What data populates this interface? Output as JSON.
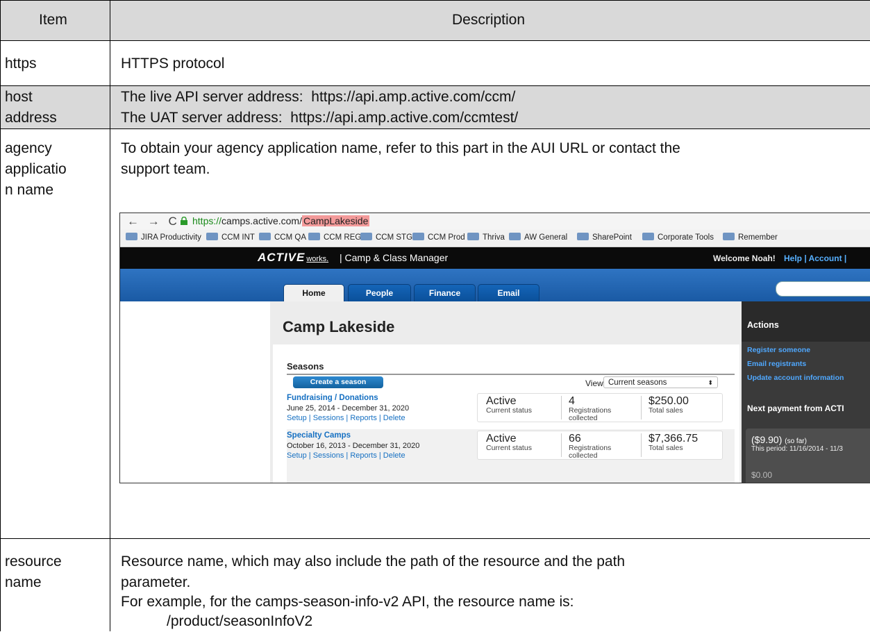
{
  "table": {
    "headers": {
      "item": "Item",
      "description": "Description"
    },
    "rows": [
      {
        "item": "https",
        "lines": [
          "HTTPS protocol"
        ]
      },
      {
        "item_lines": [
          "host",
          "address"
        ],
        "lines": [
          "The live API server address:  https://api.amp.active.com/ccm/",
          "The UAT server address:  https://api.amp.active.com/ccmtest/"
        ]
      },
      {
        "item_lines": [
          "agency",
          "applicatio",
          "n name"
        ],
        "lines": [
          "To obtain your agency application name, refer to this part in the AUI URL or contact the",
          "support team."
        ]
      },
      {
        "item_lines": [
          "resource",
          "name"
        ],
        "lines": [
          "Resource name, which may also include the path of the resource and the path",
          "parameter.",
          "For example, for the camps-season-info-v2 API, the resource name is:",
          "/product/seasonInfoV2"
        ]
      }
    ]
  },
  "screenshot": {
    "nav_glyphs": "← → C",
    "url_scheme": "https://",
    "url_host": "camps.active.com/",
    "url_path": "CampLakeside",
    "bookmarks": [
      "JIRA Productivity",
      "CCM INT",
      "CCM QA",
      "CCM REG",
      "CCM STG",
      "CCM Prod",
      "Thriva",
      "AW General",
      "SharePoint",
      "Corporate Tools",
      "Remember"
    ],
    "logo": "ACTIVE",
    "logo_works": "works.",
    "app_title": "|  Camp & Class Manager",
    "welcome": "Welcome Noah!",
    "top_links": "Help | Account |",
    "tabs": [
      "Home",
      "People",
      "Finance",
      "Email"
    ],
    "page_title": "Camp Lakeside",
    "seasons_heading": "Seasons",
    "create_button": "Create a season",
    "view_label": "View",
    "view_value": "Current seasons",
    "seasons": [
      {
        "name": "Fundraising / Donations",
        "dates": "June 25, 2014 - December 31, 2020",
        "links": "Setup | Sessions | Reports | Delete",
        "status": "Active",
        "status_label": "Current status",
        "count": "4",
        "count_label": "Registrations",
        "count_label2": "collected",
        "sales": "$250.00",
        "sales_label": "Total sales"
      },
      {
        "name": "Specialty Camps",
        "dates": "October 16, 2013 - December 31, 2020",
        "links": "Setup | Sessions | Reports | Delete",
        "status": "Active",
        "status_label": "Current status",
        "count": "66",
        "count_label": "Registrations",
        "count_label2": "collected",
        "sales": "$7,366.75",
        "sales_label": "Total sales"
      }
    ],
    "sidebar": {
      "title": "Actions",
      "links": [
        "Register someone",
        "Email registrants",
        "Update account information"
      ],
      "next_payment": "Next payment from ACTI",
      "amount": "($9.90)",
      "amount_note": "(so far)",
      "period": "This period: 11/16/2014 - 11/3",
      "amount2": "$0.00"
    }
  }
}
